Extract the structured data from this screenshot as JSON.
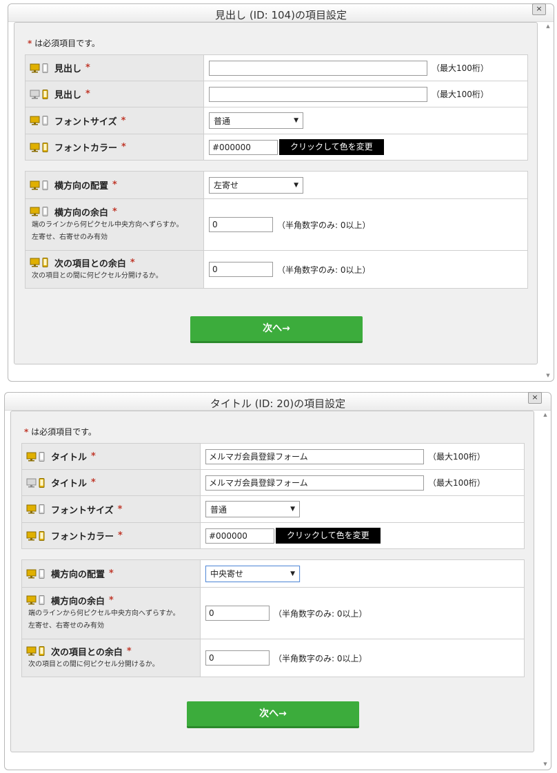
{
  "dialogs": [
    {
      "title": "見出し (ID: 104)の項目設定",
      "close_label": "×",
      "required_note": "は必須項目です。",
      "required_mark": "*",
      "text_label": "見出し",
      "text_value_pc": "",
      "text_value_sp": "",
      "max_note": "（最大100桁）",
      "font_size_label": "フォントサイズ",
      "font_size_value": "普通",
      "font_color_label": "フォントカラー",
      "font_color_value": "#000000",
      "color_button": "クリックして色を変更",
      "align_label": "横方向の配置",
      "align_value": "左寄せ",
      "hmargin_label": "横方向の余白",
      "hmargin_hint1": "端のラインから何ピクセル中央方向へずらすか。",
      "hmargin_hint2": "左寄せ、右寄せのみ有効",
      "hmargin_value": "0",
      "num_note": "（半角数字のみ: 0以上）",
      "spacing_label": "次の項目との余白",
      "spacing_hint": "次の項目との間に何ピクセル分開けるか。",
      "spacing_value": "0",
      "next_button": "次へ→"
    },
    {
      "title": "タイトル (ID: 20)の項目設定",
      "close_label": "×",
      "required_note": "は必須項目です。",
      "required_mark": "*",
      "text_label": "タイトル",
      "text_value_pc": "メルマガ会員登録フォーム",
      "text_value_sp": "メルマガ会員登録フォーム",
      "max_note": "（最大100桁）",
      "font_size_label": "フォントサイズ",
      "font_size_value": "普通",
      "font_color_label": "フォントカラー",
      "font_color_value": "#000000",
      "color_button": "クリックして色を変更",
      "align_label": "横方向の配置",
      "align_value": "中央寄せ",
      "hmargin_label": "横方向の余白",
      "hmargin_hint1": "端のラインから何ピクセル中央方向へずらすか。",
      "hmargin_hint2": "左寄せ、右寄せのみ有効",
      "hmargin_value": "0",
      "num_note": "（半角数字のみ: 0以上）",
      "spacing_label": "次の項目との余白",
      "spacing_hint": "次の項目との間に何ピクセル分開けるか。",
      "spacing_value": "0",
      "next_button": "次へ→"
    }
  ],
  "colors": {
    "next_button": "#3cac3c",
    "required_mark": "#c0392b",
    "device_icon_active": "#e0b000",
    "device_icon_inactive": "#9a9a9a",
    "color_button_bg": "#000000"
  },
  "icons": {
    "device_pc_active": "pc-sp-device-icon (pc highlighted)",
    "device_sp_active": "pc-sp-device-icon (smartphone highlighted)",
    "device_both": "pc-sp-device-icon (both highlighted)"
  }
}
